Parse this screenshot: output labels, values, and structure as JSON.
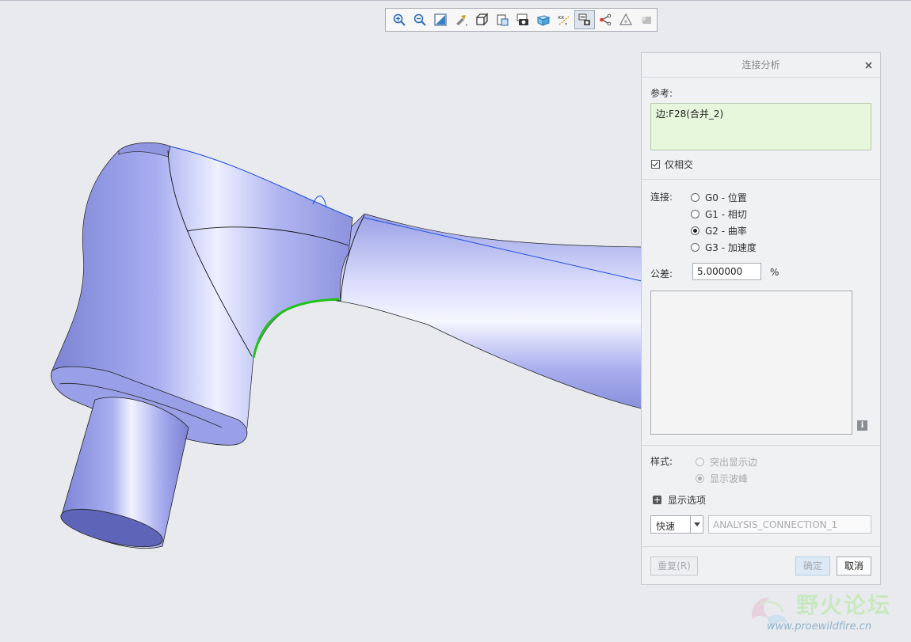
{
  "dialog": {
    "title": "连接分析",
    "reference_label": "参考:",
    "reference_value": "边:F28(合并_2)",
    "intersect_only_label": "仅相交",
    "intersect_only_checked": true,
    "connection_label": "连接:",
    "connection_options": [
      "G0 - 位置",
      "G1 - 相切",
      "G2 - 曲率",
      "G3 - 加速度"
    ],
    "connection_selected": "G2 - 曲率",
    "tolerance_label": "公差:",
    "tolerance_value": "5.000000",
    "tolerance_unit": "%",
    "style_label": "样式:",
    "style_options": [
      "突出显示边",
      "显示波峰"
    ],
    "style_selected": "显示波峰",
    "display_options_label": "显示选项",
    "mode_value": "快速",
    "analysis_name": "ANALYSIS_CONNECTION_1",
    "buttons": {
      "repeat": "重复(R)",
      "ok": "确定",
      "cancel": "取消"
    }
  },
  "toolbar": {
    "icons": [
      "zoom-in-icon",
      "zoom-out-icon",
      "refit-icon",
      "reorient-icon",
      "display-style-icon",
      "saved-views-icon",
      "view-manager-icon",
      "perspective-icon",
      "datum-display-icon",
      "annotation-display-icon",
      "spin-center-icon",
      "repaint-icon",
      "appearance-icon"
    ],
    "active_icon": "annotation-display-icon"
  },
  "watermark": {
    "title": "野火论坛",
    "url": "www.proewildfire.cn"
  },
  "colors": {
    "model": "#a3a9ec",
    "highlight_edge": "#22c21c",
    "ref_box": "#e6f7dc",
    "background": "#e8eaee"
  }
}
